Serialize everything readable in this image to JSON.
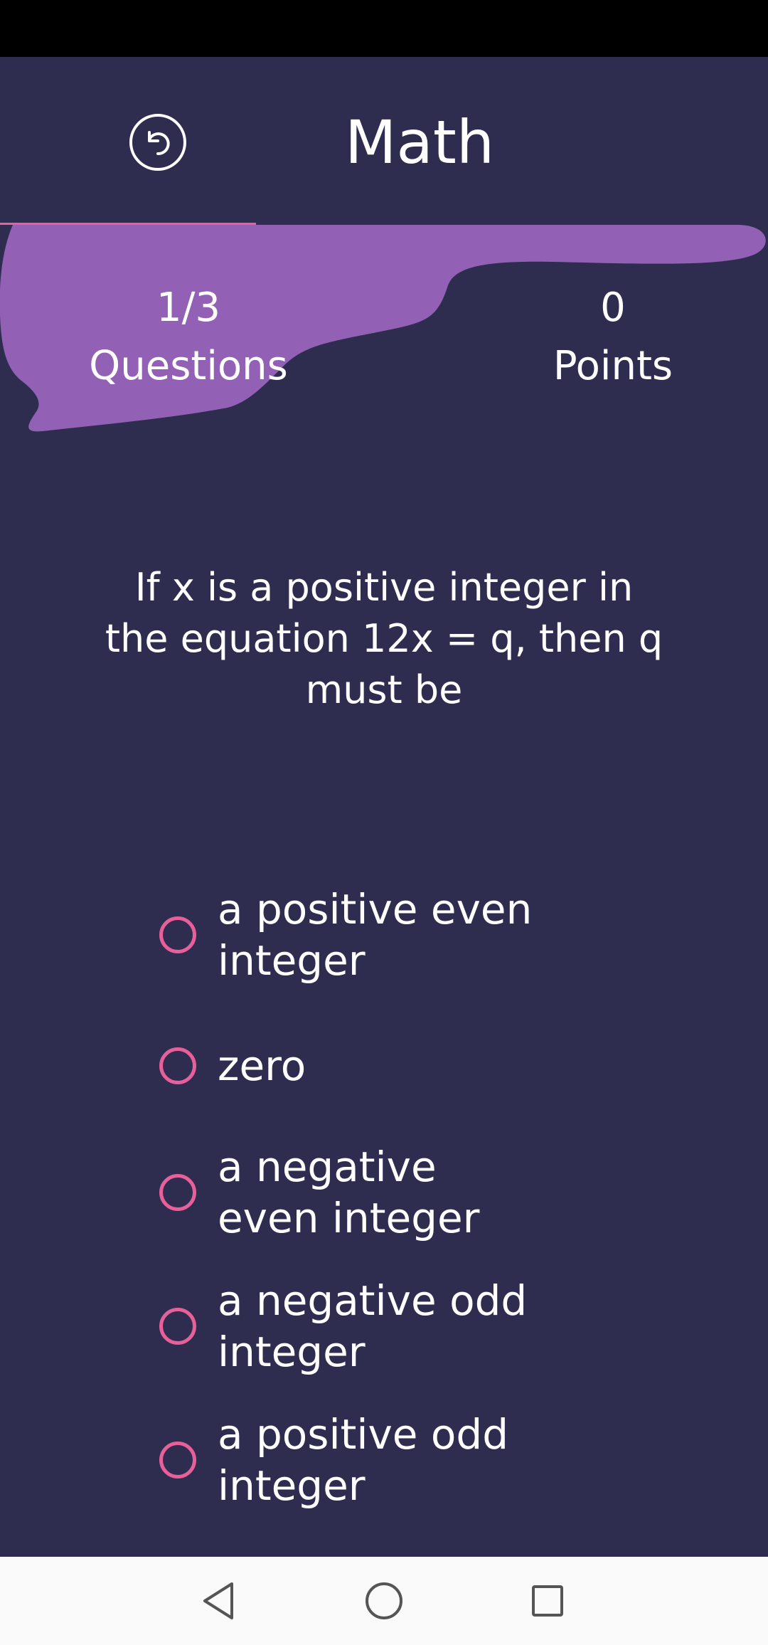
{
  "header": {
    "title": "Math",
    "back_icon": "undo-arrow-icon"
  },
  "stats": {
    "questions_value": "1/3",
    "questions_label": "Questions",
    "points_value": "0",
    "points_label": "Points"
  },
  "question": {
    "text": "If x is a positive integer in the equation 12x = q, then q must be"
  },
  "options": [
    {
      "label": "a positive even integer"
    },
    {
      "label": "zero"
    },
    {
      "label": "a negative even integer"
    },
    {
      "label": "a negative odd integer"
    },
    {
      "label": "a positive odd integer"
    }
  ],
  "navigation": {
    "back_icon": "triangle-back-icon",
    "home_icon": "circle-home-icon",
    "recents_icon": "square-recents-icon"
  },
  "colors": {
    "background": "#2e2d4f",
    "accent": "#e8609a",
    "blob": "#9260b4",
    "status_bar": "#000000",
    "nav_bar": "#fafafa"
  },
  "progress": 0.3333
}
